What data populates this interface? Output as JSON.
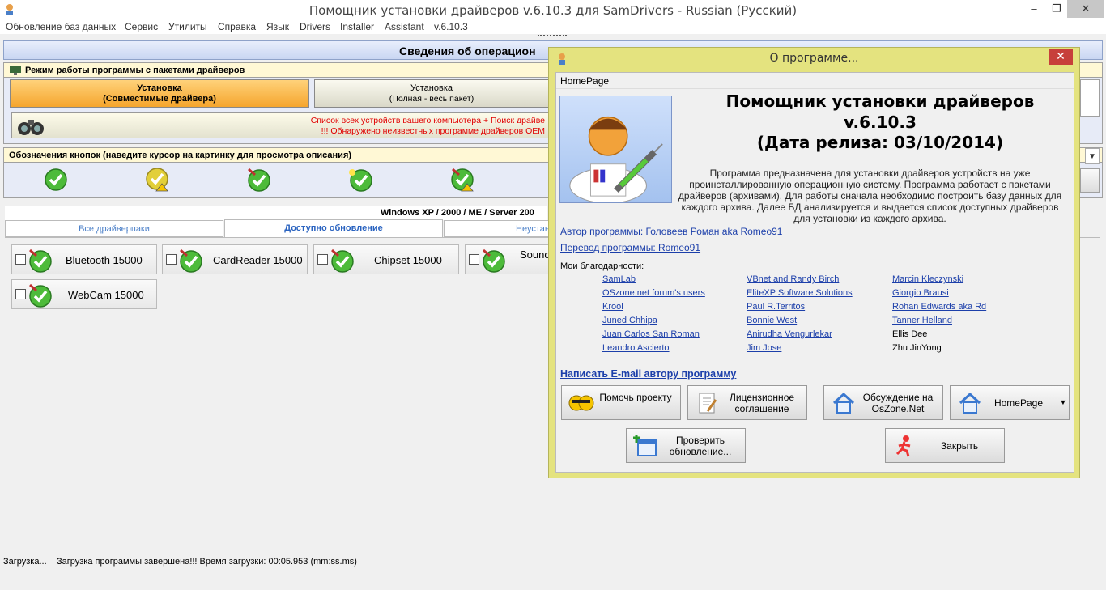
{
  "window": {
    "title": "Помощник установки драйверов v.6.10.3 для SamDrivers - Russian (Русский)",
    "minimize": "–",
    "maximize": "❐",
    "close": "✕"
  },
  "menu": [
    "Обновление баз данных",
    "Сервис",
    "Утилиты",
    "Справка",
    "Язык",
    "Drivers",
    "Installer",
    "Assistant",
    "v.6.10.3"
  ],
  "header": {
    "title": "Сведения об операцион"
  },
  "mode_group": {
    "title": "Режим работы программы с пакетами драйверов",
    "buttons": [
      {
        "line1": "Установка",
        "line2": "(Совместимые драйвера)"
      },
      {
        "line1": "Установка",
        "line2": "(Полная - весь пакет)"
      }
    ],
    "info_line1": "Список всех устройств вашего компьютера + Поиск драйве",
    "info_line2": "!!! Обнаружено неизвестных программе драйверов OEM"
  },
  "legend_group": {
    "title": "Обозначения кнопок (наведите курсор на картинку для просмотра описания)"
  },
  "os_bar": "Windows XP / 2000 / ME / Server 200",
  "tabs": [
    "Все драйверпаки",
    "Доступно обновление",
    "Неустан"
  ],
  "drivers": [
    {
      "label": "Bluetooth 15000"
    },
    {
      "label": "CardReader 15000"
    },
    {
      "label": "Chipset 15000"
    },
    {
      "label": "Sound"
    },
    {
      "label": "WebCam 15000"
    }
  ],
  "status": {
    "left": "Загрузка...",
    "message": "Загрузка программы завершена!!! Время загрузки: 00:05.953 (mm:ss.ms)"
  },
  "dialog": {
    "title": "О программе...",
    "menu_homepage": "HomePage",
    "heading1": "Помощник установки драйверов",
    "heading2": "v.6.10.3",
    "heading3": "(Дата релиза: 03/10/2014)",
    "description": "Программа предназначена для установки драйверов устройств на уже проинсталлированную операционную систему. Программа работает с пакетами драйверов (архивами). Для работы сначала необходимо построить базу данных для каждого архива. Далее БД анализируется и выдается список доступных драйверов для установки из каждого архива.",
    "author_link": "Автор программы: Головеев Роман aka Romeo91",
    "translation_link": "Перевод программы: Romeo91",
    "thanks_label": "Мои благодарности:",
    "credits_col1": [
      "SamLab",
      "OSzone.net forum's users",
      "Krool",
      "Juned Chhipa",
      "Juan Carlos San Roman",
      "Leandro Ascierto"
    ],
    "credits_col2": [
      "VBnet and Randy Birch",
      "EliteXP Software Solutions",
      "Paul R.Territos",
      "Bonnie West",
      "Anirudha Vengurlekar",
      "Jim Jose"
    ],
    "credits_col3_links": [
      "Marcin Kleczynski",
      "Giorgio Brausi",
      "Rohan Edwards aka Rd",
      "Tanner Helland"
    ],
    "credits_col3_plain": [
      "Ellis Dee",
      "Zhu JinYong"
    ],
    "email_link": "Написать E-mail автору программу",
    "buttons": {
      "help": "Помочь проекту",
      "license": "Лицензионное соглашение",
      "discuss": "Обсуждение на OsZone.Net",
      "homepage": "HomePage",
      "check_update": "Проверить обновление...",
      "close": "Закрыть"
    }
  },
  "colors": {
    "accent_orange": "#f5a52d",
    "dialog_frame": "#e4e37f",
    "link": "#1c3faa",
    "warning_red": "#e00000"
  }
}
